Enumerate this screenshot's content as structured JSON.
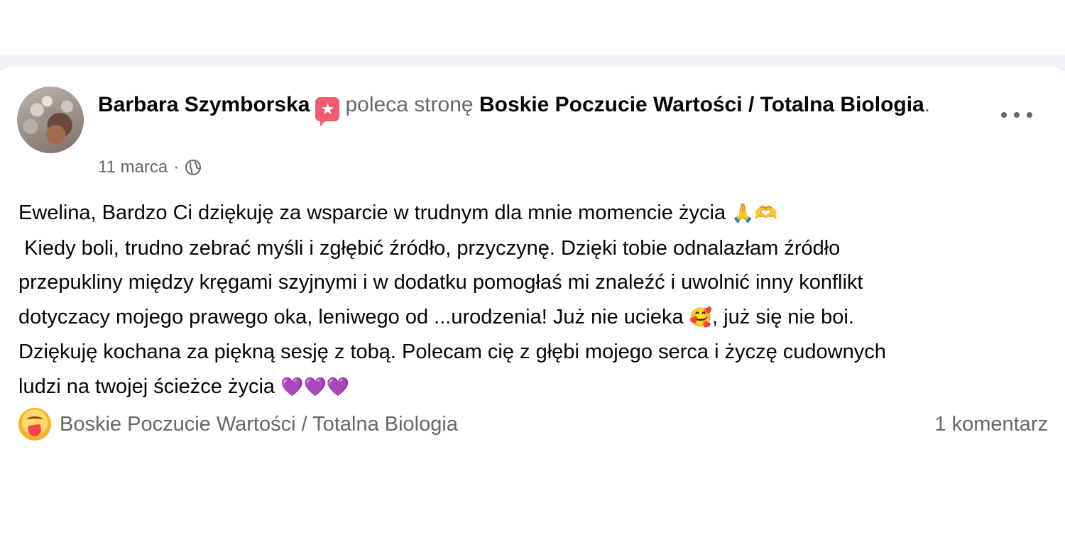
{
  "post": {
    "author": "Barbara Szymborska",
    "action": "poleca stronę",
    "page_name": "Boskie Poczucie Wartości / Totalna Biologia",
    "period": ".",
    "date": "11 marca",
    "separator": "·",
    "body_lines": [
      "Ewelina, Bardzo Ci dziękuję za wsparcie w trudnym dla mnie momencie życia ",
      " Kiedy boli, trudno zebrać myśli i zgłębić źródło, przyczynę. Dzięki tobie odnalazłam źródło",
      "przepukliny między kręgami szyjnymi i w dodatku pomogłaś mi znaleźć i uwolnić inny konflikt",
      "dotyczacy mojego prawego oka, leniwego od ...urodzenia! Już nie ucieka ",
      ", już się nie boi.",
      "Dziękuję kochana za piękną sesję z tobą. Polecam cię z głębi mojego serca i życzę cudownych",
      "ludzi na twojej ścieżce życia "
    ],
    "emojis": {
      "pray": "🙏",
      "heart_hands": "🫶",
      "smiling_hearts": "🥰",
      "purple_hearts": "💜💜💜"
    },
    "footer": {
      "reaction_icon": "care-icon",
      "page_name": "Boskie Poczucie Wartości / Totalna Biologia",
      "comments": "1 komentarz"
    },
    "icons": {
      "recommend": "recommend-badge-icon",
      "privacy": "globe-icon",
      "menu": "more-options-icon"
    }
  },
  "colors": {
    "text": "#050505",
    "muted": "#65676b",
    "recommend_badge": "#f25b6e",
    "purple_heart": "#8b3dff"
  }
}
